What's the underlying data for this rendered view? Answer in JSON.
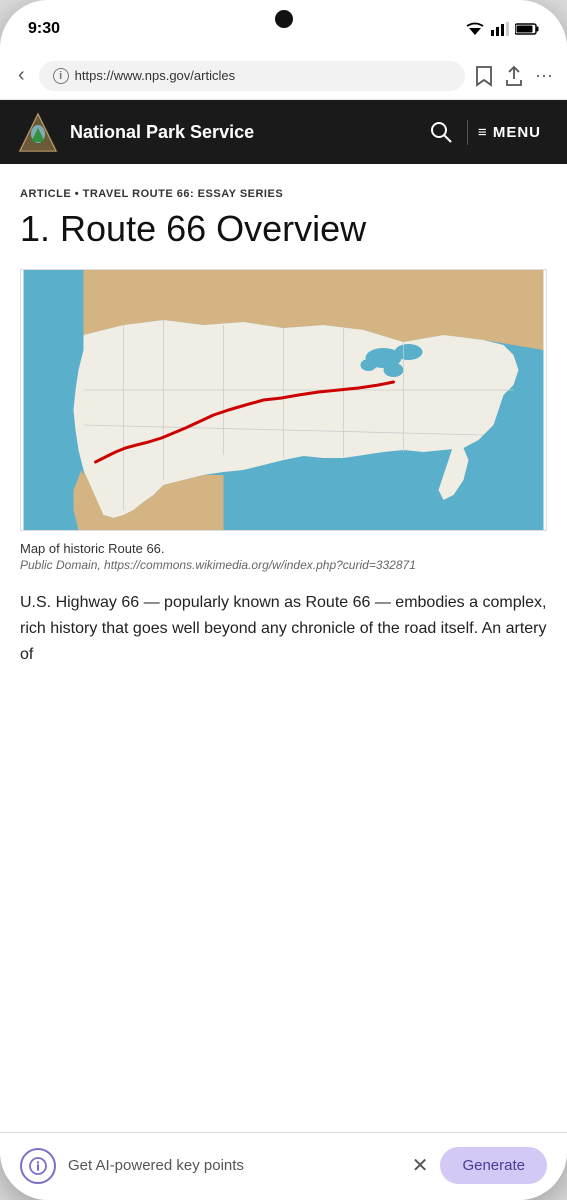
{
  "status": {
    "time": "9:30"
  },
  "browser": {
    "url": "https://www.nps.gov/articles",
    "back_label": "‹"
  },
  "nps_header": {
    "title": "National Park Service",
    "menu_label": "≡ MENU"
  },
  "article": {
    "category": "ARTICLE • TRAVEL ROUTE 66: ESSAY SERIES",
    "title": "1. Route 66 Overview",
    "map_caption": "Map of historic Route 66.",
    "map_attribution": "Public Domain, https://commons.wikimedia.org/w/index.php?curid=332871",
    "body_text": "U.S. Highway 66 — popularly known as Route 66 — embodies a complex, rich history that goes well beyond any chronicle of the road itself. An artery of"
  },
  "bottom_bar": {
    "ai_label": "Get AI-powered key points",
    "generate_label": "Generate"
  }
}
